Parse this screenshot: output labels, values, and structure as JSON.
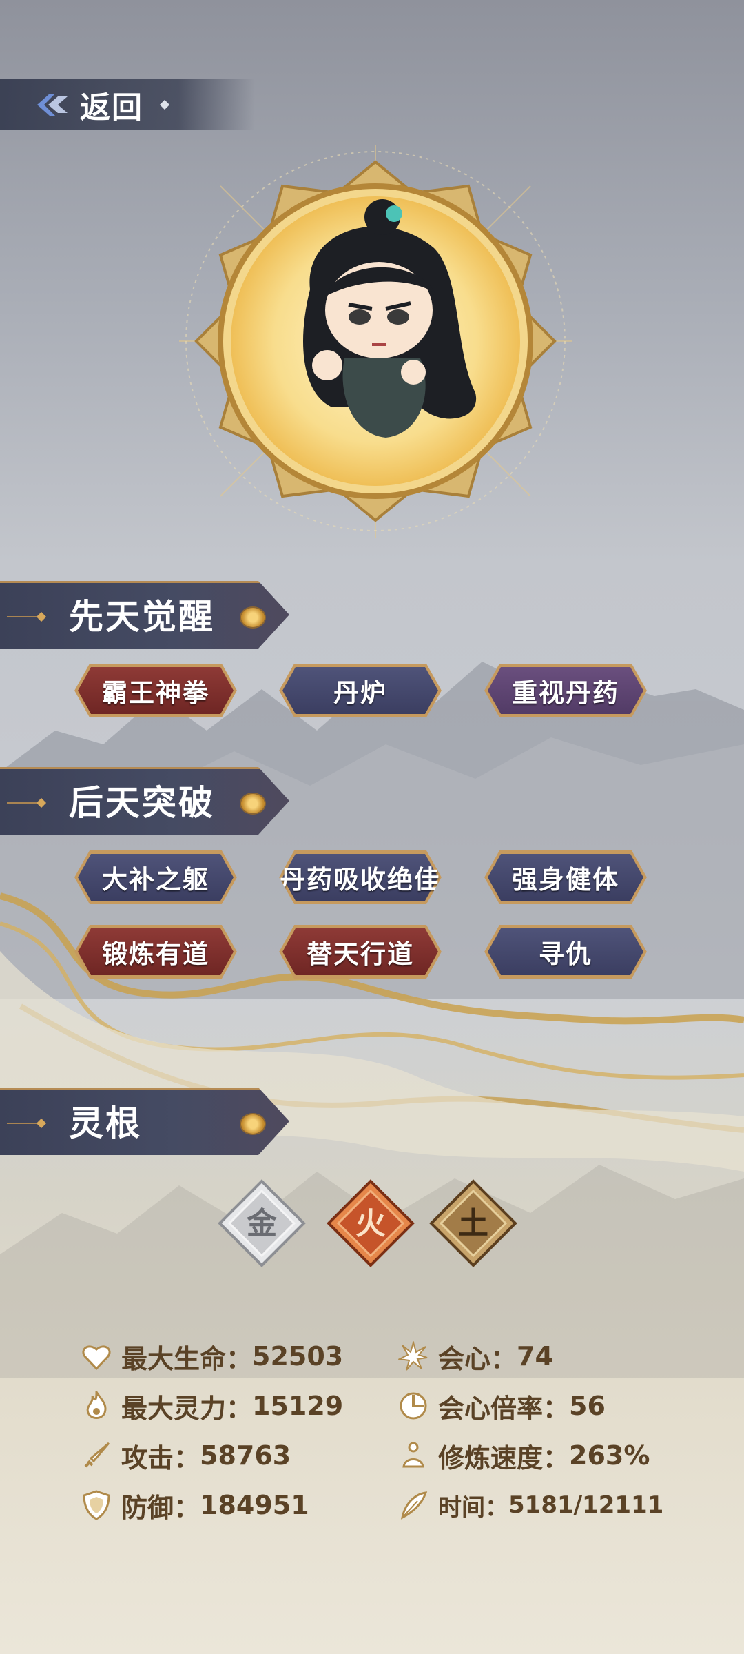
{
  "nav": {
    "back_label": "返回"
  },
  "sections": {
    "innate_title": "先天觉醒",
    "acquired_title": "后天突破",
    "spirit_root_title": "灵根"
  },
  "innate_traits": [
    {
      "label": "霸王神拳",
      "color": "red"
    },
    {
      "label": "丹炉",
      "color": "blue"
    },
    {
      "label": "重视丹药",
      "color": "purple"
    }
  ],
  "acquired_traits": [
    {
      "label": "大补之躯",
      "color": "blue"
    },
    {
      "label": "丹药吸收绝佳",
      "color": "blue"
    },
    {
      "label": "强身健体",
      "color": "blue"
    },
    {
      "label": "锻炼有道",
      "color": "red"
    },
    {
      "label": "替天行道",
      "color": "red"
    },
    {
      "label": "寻仇",
      "color": "blue"
    }
  ],
  "spirit_roots": [
    {
      "glyph": "金",
      "color": "#c9cacd",
      "icon": "metal-root-icon"
    },
    {
      "glyph": "火",
      "color": "#c6542a",
      "icon": "fire-root-icon"
    },
    {
      "glyph": "土",
      "color": "#a27c48",
      "icon": "earth-root-icon"
    }
  ],
  "stats": {
    "max_hp": {
      "label": "最大生命：",
      "value": "52503",
      "icon": "heart-icon"
    },
    "crit": {
      "label": "会心：",
      "value": "74",
      "icon": "starburst-icon"
    },
    "max_spirit": {
      "label": "最大灵力：",
      "value": "15129",
      "icon": "flame-icon"
    },
    "crit_rate": {
      "label": "会心倍率：",
      "value": "56",
      "icon": "target-icon"
    },
    "attack": {
      "label": "攻击：",
      "value": "58763",
      "icon": "sword-icon"
    },
    "cultivation_speed": {
      "label": "修炼速度：",
      "value": "263%",
      "icon": "meditate-icon"
    },
    "defense": {
      "label": "防御：",
      "value": "184951",
      "icon": "shield-icon"
    },
    "time": {
      "label": "时间：",
      "value": "5181/12111",
      "icon": "feather-icon"
    }
  }
}
